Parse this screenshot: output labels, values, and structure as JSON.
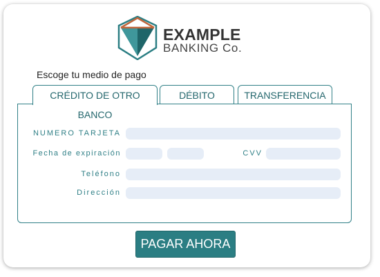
{
  "brand": {
    "name_line1": "EXAMPLE",
    "name_line2": "BANKING Co.",
    "colors": {
      "teal": "#2b7e83",
      "accent": "#c0673d",
      "dark": "#333333"
    }
  },
  "payment": {
    "prompt": "Escoge tu medio de pago",
    "tabs": [
      {
        "label": "CRÉDITO DE OTRO BANCO",
        "active": true
      },
      {
        "label": "DÉBITO",
        "active": false
      },
      {
        "label": "TRANSFERENCIA",
        "active": false
      }
    ]
  },
  "form": {
    "card_number_label": "NUMERO TARJETA",
    "expiry_label": "Fecha de expiración",
    "cvv_label": "CVV",
    "phone_label": "Teléfono",
    "address_label": "Dirección",
    "card_number_value": "",
    "expiry_month_value": "",
    "expiry_year_value": "",
    "cvv_value": "",
    "phone_value": "",
    "address_value": ""
  },
  "actions": {
    "pay_label": "PAGAR AHORA"
  }
}
